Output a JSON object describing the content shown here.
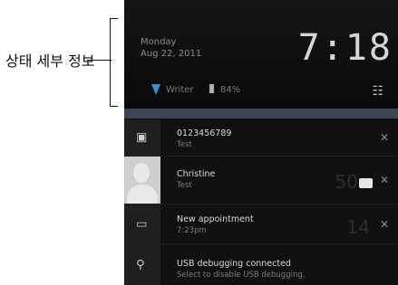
{
  "annotation": {
    "text": "상태 세부 정보"
  },
  "status": {
    "day": "Monday",
    "date": "Aug 22, 2011",
    "time": "7:18",
    "network": "Writer",
    "battery": "84%",
    "signal_icon": "signal-icon",
    "battery_icon": "battery-icon",
    "settings_icon": "settings-icon"
  },
  "notifications": [
    {
      "title": "0123456789",
      "subtitle": "Test",
      "icon": "message-icon"
    },
    {
      "title": "Christine",
      "subtitle": "Test",
      "count": "50",
      "icon": "contact-avatar"
    },
    {
      "title": "New appointment",
      "subtitle": "7:23pm",
      "count": "14",
      "icon": "calendar-icon"
    },
    {
      "title": "USB debugging connected",
      "subtitle": "Select to disable USB debugging.",
      "icon": "usb-icon"
    }
  ]
}
